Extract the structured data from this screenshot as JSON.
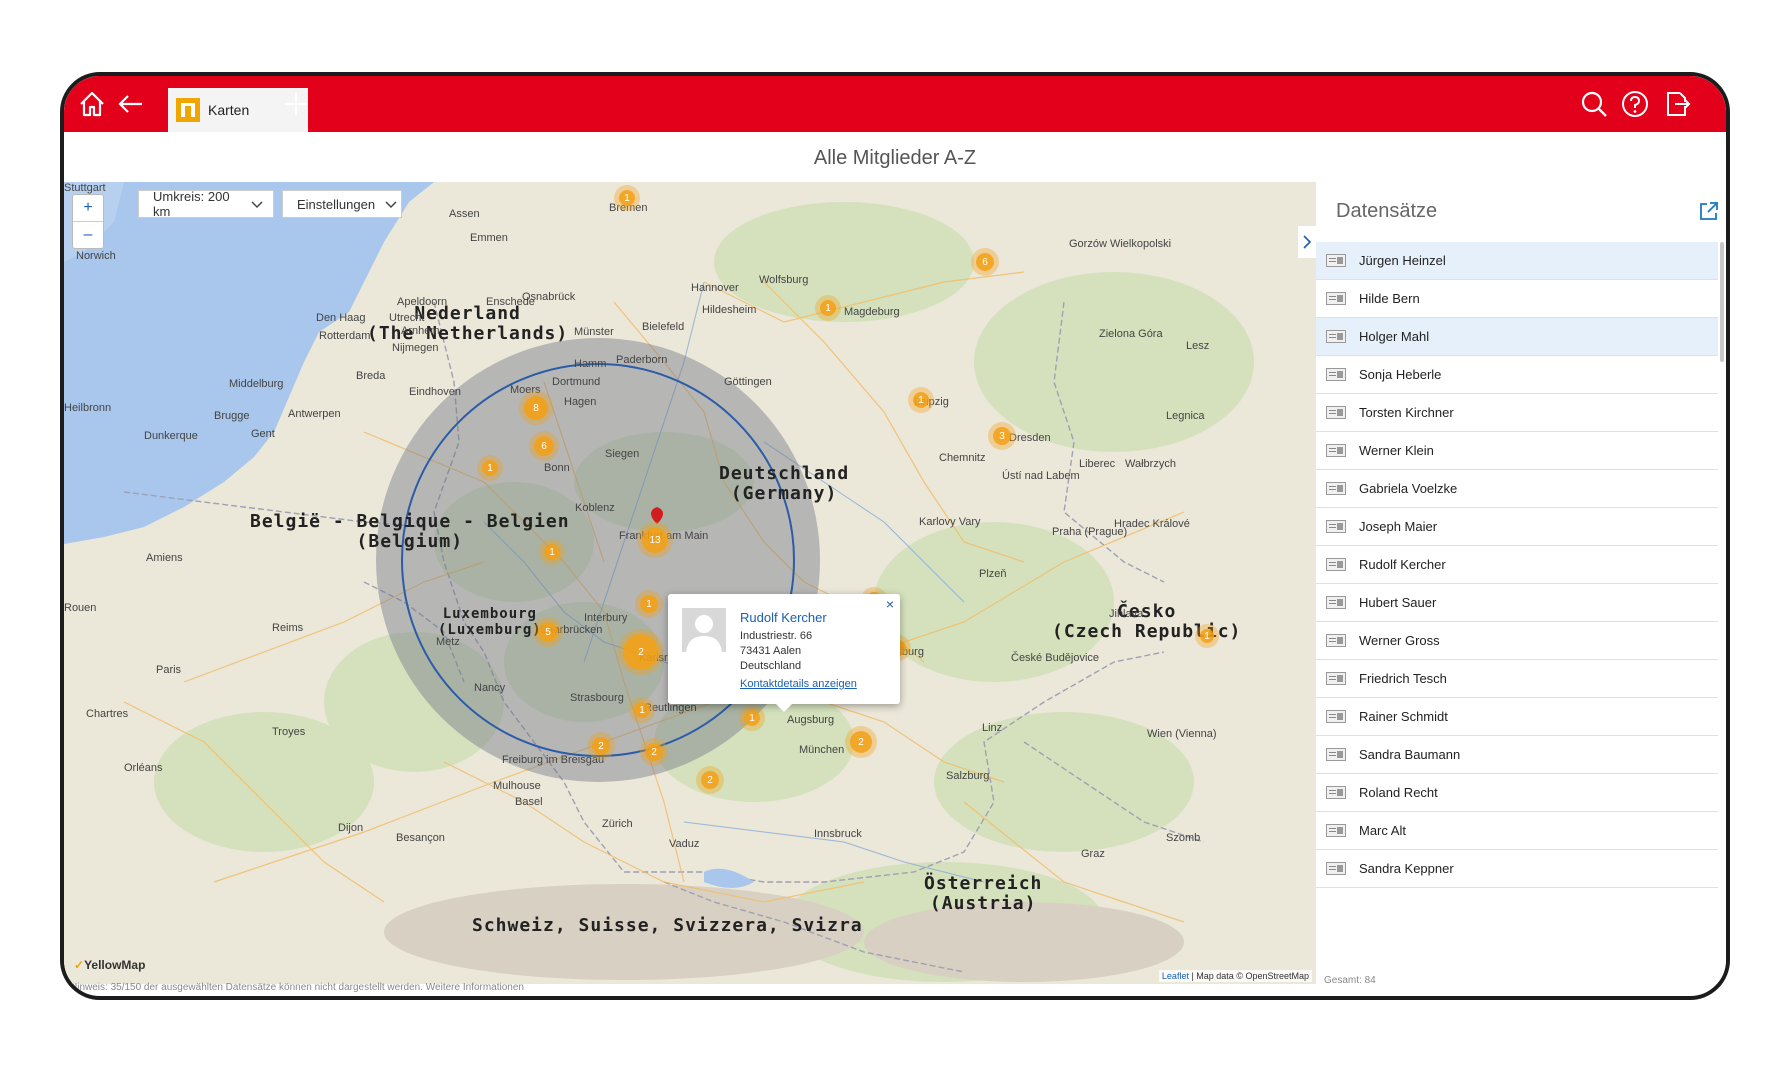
{
  "colors": {
    "brand_red": "#e2001a",
    "cluster_orange": "#f4a014",
    "link_blue": "#1a5fb4"
  },
  "topbar": {
    "home_icon": "home-icon",
    "back_icon": "arrow-left-icon",
    "tab_label": "Karten",
    "add_icon": "plus-icon",
    "search_icon": "search-icon",
    "help_icon": "help-icon",
    "logout_icon": "logout-icon"
  },
  "page_title": "Alle Mitglieder A-Z",
  "map": {
    "zoom_in": "+",
    "zoom_out": "–",
    "radius_label": "Umkreis: 200 km",
    "settings_label": "Einstellungen",
    "countries": {
      "nl": [
        "Nederland",
        "(The Netherlands)"
      ],
      "de": [
        "Deutschland",
        "(Germany)"
      ],
      "be": [
        "België - Belgique - Belgien",
        "(Belgium)"
      ],
      "lu": [
        "Luxembourg",
        "(Luxemburg)"
      ],
      "cz": [
        "Česko",
        "(Czech Republic)"
      ],
      "at": [
        "Österreich",
        "(Austria)"
      ],
      "ch": [
        "Schweiz, Suisse, Svizzera, Svizra"
      ]
    },
    "cities": [
      "Bremen",
      "Assen",
      "Emmen",
      "Norwich",
      "Hannover",
      "Wolfsburg",
      "Apeldoorn",
      "Enschede",
      "Osnabrück",
      "Den Haag",
      "Utrecht",
      "Arnhem",
      "Rotterdam",
      "Nijmegen",
      "Münster",
      "Bielefeld",
      "Hildesheim",
      "Magdeburg",
      "Gorzów Wielkopolski",
      "Zielona Góra",
      "Breda",
      "Eindhoven",
      "Middelburg",
      "Paderborn",
      "Hamm",
      "Dortmund",
      "Moers",
      "Hagen",
      "Göttingen",
      "Leipzig",
      "Brugge",
      "Antwerpen",
      "Dunkerque",
      "Gent",
      "Siegen",
      "Bonn",
      "Dresden",
      "Chemnitz",
      "Liberec",
      "Ústí nad Labem",
      "Koblenz",
      "Frankfurt am Main",
      "Karlovy Vary",
      "Hradec Králové",
      "Praha (Prague)",
      "Amiens",
      "Plzeň",
      "Rouen",
      "Reims",
      "Saarbrücken",
      "Metz",
      "Regensburg",
      "Jihlava",
      "Paris",
      "Nancy",
      "Strasbourg",
      "Reutlingen",
      "Ingolstadt",
      "České Budějovice",
      "Chartres",
      "Troyes",
      "Augsburg",
      "Linz",
      "Wien (Vienna)",
      "Orléans",
      "Freiburg im Breisgau",
      "München",
      "Mulhouse",
      "Basel",
      "Salzburg",
      "Dijon",
      "Zürich",
      "Besançon",
      "Innsbruck",
      "Vaduz",
      "Graz",
      "Szomb",
      "Legnica",
      "Wałbrzych",
      "Lesz",
      "Heilbronn",
      "Interbury",
      "Karlsruhe",
      "Stuttgart"
    ],
    "clusters": [
      "1",
      "6",
      "1",
      "1",
      "8",
      "6",
      "1",
      "1",
      "3",
      "13",
      "1",
      "1",
      "5",
      "2",
      "16",
      "1",
      "1",
      "1",
      "2",
      "2",
      "2",
      "1",
      "1",
      "2"
    ],
    "popup": {
      "name": "Rudolf Kercher",
      "street": "Industriestr. 66",
      "city": "73431 Aalen",
      "country": "Deutschland",
      "link": "Kontaktdetails anzeigen",
      "close": "×"
    },
    "logo": "YellowMap",
    "attribution_leaflet": "Leaflet",
    "attribution_rest": " | Map data © OpenStreetMap",
    "hint": "Hinweis: 35/150 der ausgewählten Datensätze können nicht dargestellt werden.  Weitere Informationen"
  },
  "sidebar": {
    "title": "Datensätze",
    "records": [
      "Jürgen Heinzel",
      "Hilde Bern",
      "Holger Mahl",
      "Sonja Heberle",
      "Torsten Kirchner",
      "Werner Klein",
      "Gabriela Voelzke",
      "Joseph Maier",
      "Rudolf Kercher",
      "Hubert Sauer",
      "Werner Gross",
      "Friedrich Tesch",
      "Rainer Schmidt",
      "Sandra Baumann",
      "Roland Recht",
      "Marc Alt",
      "Sandra Keppner"
    ],
    "selected": [
      "Jürgen Heinzel",
      "Holger Mahl"
    ],
    "total": "Gesamt: 84"
  }
}
